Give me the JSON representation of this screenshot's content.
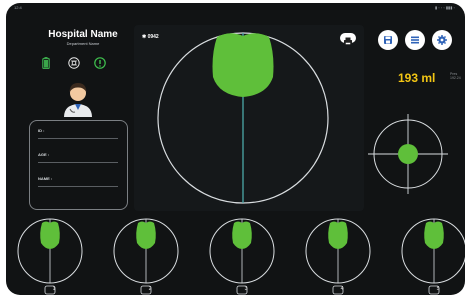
{
  "status": {
    "left": "12:4",
    "right": "▮ ◦ ◦ ◦ ▮▮▮ ◦"
  },
  "hospital": {
    "name": "Hospital Name",
    "department": "Department Name"
  },
  "status_icons": [
    "battery-icon",
    "settings-circle-icon",
    "help-icon"
  ],
  "patient": {
    "fields": [
      {
        "label": "ID :",
        "value": ""
      },
      {
        "label": "AGE :",
        "value": ""
      },
      {
        "label": "NAME :",
        "value": ""
      }
    ]
  },
  "scan": {
    "serial": "0942",
    "print_icon": "printer-icon"
  },
  "toolbar": {
    "buttons": [
      "save-icon",
      "list-icon",
      "settings-icon"
    ]
  },
  "result": {
    "volume": "193 ml",
    "meta_line1": "Pres",
    "meta_line2": "192.24"
  },
  "thumbnails": [
    {
      "label": "1"
    },
    {
      "label": "2"
    },
    {
      "label": "3"
    },
    {
      "label": "4"
    },
    {
      "label": "5"
    }
  ],
  "colors": {
    "accent_green": "#5fbf3a",
    "accent_blue": "#2f63b8",
    "volume_yellow": "#f3c614",
    "scan_line": "#4fb3b3"
  }
}
